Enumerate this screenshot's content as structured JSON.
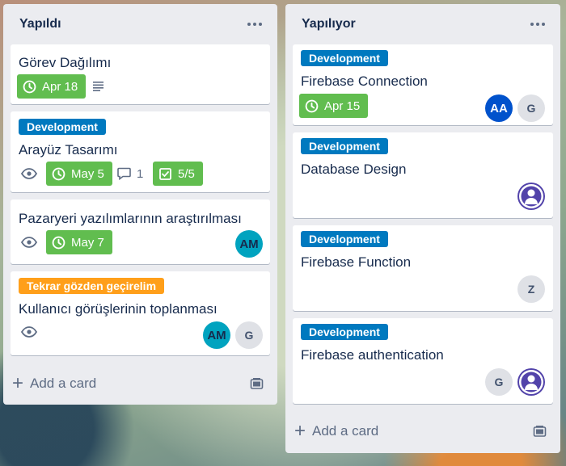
{
  "lists": [
    {
      "title": "Yapıldı",
      "add_card": "Add a card",
      "cards": [
        {
          "title": "Görev Dağılımı",
          "due": "Apr 18"
        },
        {
          "label": "Development",
          "title": "Arayüz Tasarımı",
          "due": "May 5",
          "comments": "1",
          "checklist": "5/5"
        },
        {
          "title": "Pazaryeri yazılımlarının araştırılması",
          "due": "May 7",
          "members": [
            "AM"
          ]
        },
        {
          "label": "Tekrar gözden geçirelim",
          "title": "Kullanıcı görüşlerinin toplanması",
          "members": [
            "AM",
            "G"
          ]
        }
      ]
    },
    {
      "title": "Yapılıyor",
      "add_card": "Add a card",
      "cards": [
        {
          "label": "Development",
          "title": "Firebase Connection",
          "due": "Apr 15",
          "members": [
            "AA",
            "G"
          ]
        },
        {
          "label": "Development",
          "title": "Database Design"
        },
        {
          "label": "Development",
          "title": "Firebase Function",
          "members": [
            "Z"
          ]
        },
        {
          "label": "Development",
          "title": "Firebase authentication",
          "members": [
            "G"
          ]
        }
      ]
    }
  ],
  "colors": {
    "label_blue": "#0079bf",
    "label_orange": "#ff9f1a",
    "due_complete": "#61bd4f",
    "avatar_teal": "#00a3bf",
    "avatar_blue": "#0052cc",
    "avatar_purple": "#5243aa"
  },
  "icons": [
    "clock-icon",
    "description-icon",
    "eye-icon",
    "comment-icon",
    "checklist-icon",
    "plus-icon",
    "card-template-icon",
    "more-icon",
    "user-icon"
  ]
}
